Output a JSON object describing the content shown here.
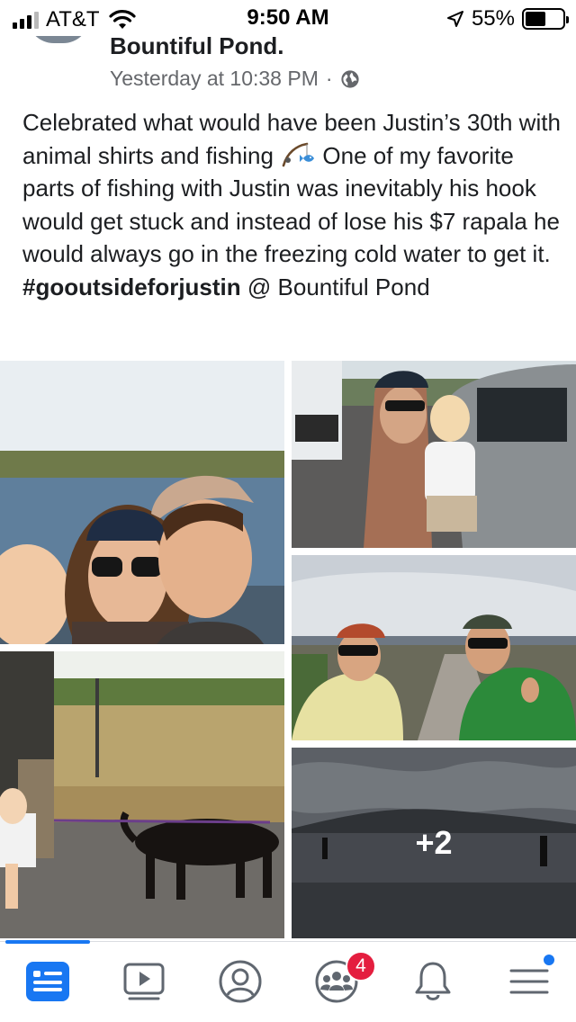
{
  "status_bar": {
    "carrier": "AT&T",
    "time": "9:50 AM",
    "battery": "55%",
    "battery_level": 0.55,
    "signal_bars": 3
  },
  "post": {
    "author": "Bountiful Pond.",
    "timestamp": "Yesterday at 10:38 PM",
    "separator": "·",
    "privacy_icon": "globe-icon",
    "text_part1": "Celebrated what would have been Justin’s 30th with animal shirts and fishing",
    "emoji_icon": "fishing-rod-icon",
    "text_part2": "One of my favorite parts of fishing with Justin was inevitably his hook would get stuck and instead of lose his $7 rapala he would always go in the freezing cold water to get it.",
    "hashtag": "#gooutsideforjustin",
    "location": "@ Bountiful Pond",
    "more_photos": "+2"
  },
  "tab_bar": {
    "tabs": [
      {
        "name": "news-feed-icon",
        "active": true
      },
      {
        "name": "watch-icon"
      },
      {
        "name": "profile-icon"
      },
      {
        "name": "groups-icon",
        "badge": "4"
      },
      {
        "name": "notifications-icon"
      },
      {
        "name": "menu-icon",
        "dot": true
      }
    ],
    "accent": "#1877f2",
    "badge_color": "#e41e3f"
  }
}
